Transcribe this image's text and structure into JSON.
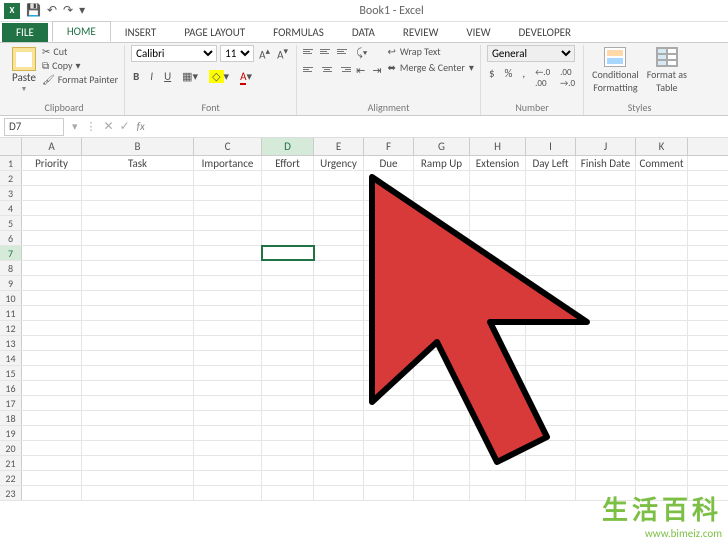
{
  "title": "Book1 - Excel",
  "qat": {
    "save": "Save",
    "undo": "Undo",
    "redo": "Redo"
  },
  "tabs": {
    "file": "FILE",
    "home": "HOME",
    "insert": "INSERT",
    "page_layout": "PAGE LAYOUT",
    "formulas": "FORMULAS",
    "data": "DATA",
    "review": "REVIEW",
    "view": "VIEW",
    "developer": "DEVELOPER"
  },
  "ribbon": {
    "clipboard": {
      "label": "Clipboard",
      "paste": "Paste",
      "cut": "Cut",
      "copy": "Copy",
      "format_painter": "Format Painter"
    },
    "font": {
      "label": "Font",
      "name": "Calibri",
      "size": "11",
      "b": "B",
      "i": "I",
      "u": "U"
    },
    "alignment": {
      "label": "Alignment",
      "wrap": "Wrap Text",
      "merge": "Merge & Center"
    },
    "number": {
      "label": "Number",
      "format": "General",
      "currency": "$",
      "percent": "%",
      "comma": ",",
      "inc": "←.0",
      "dec": ".00→"
    },
    "styles": {
      "label": "Styles",
      "cond": "Conditional\nFormatting",
      "table": "Format as\nTable"
    }
  },
  "name_box": "D7",
  "columns": [
    "A",
    "B",
    "C",
    "D",
    "E",
    "F",
    "G",
    "H",
    "I",
    "J",
    "K"
  ],
  "col_widths": [
    "c-A",
    "c-B",
    "c-C",
    "c-D",
    "c-E",
    "c-F",
    "c-G",
    "c-H",
    "c-I",
    "c-J",
    "c-K"
  ],
  "active_col": "D",
  "active_row": 7,
  "headers": [
    "Priority",
    "Task",
    "Importance",
    "Effort",
    "Urgency",
    "Due",
    "Ramp Up",
    "Extension",
    "Day Left",
    "Finish Date",
    "Comment"
  ],
  "row_count": 23,
  "watermark": {
    "text": "生活百科",
    "url": "www.bimeiz.com"
  }
}
